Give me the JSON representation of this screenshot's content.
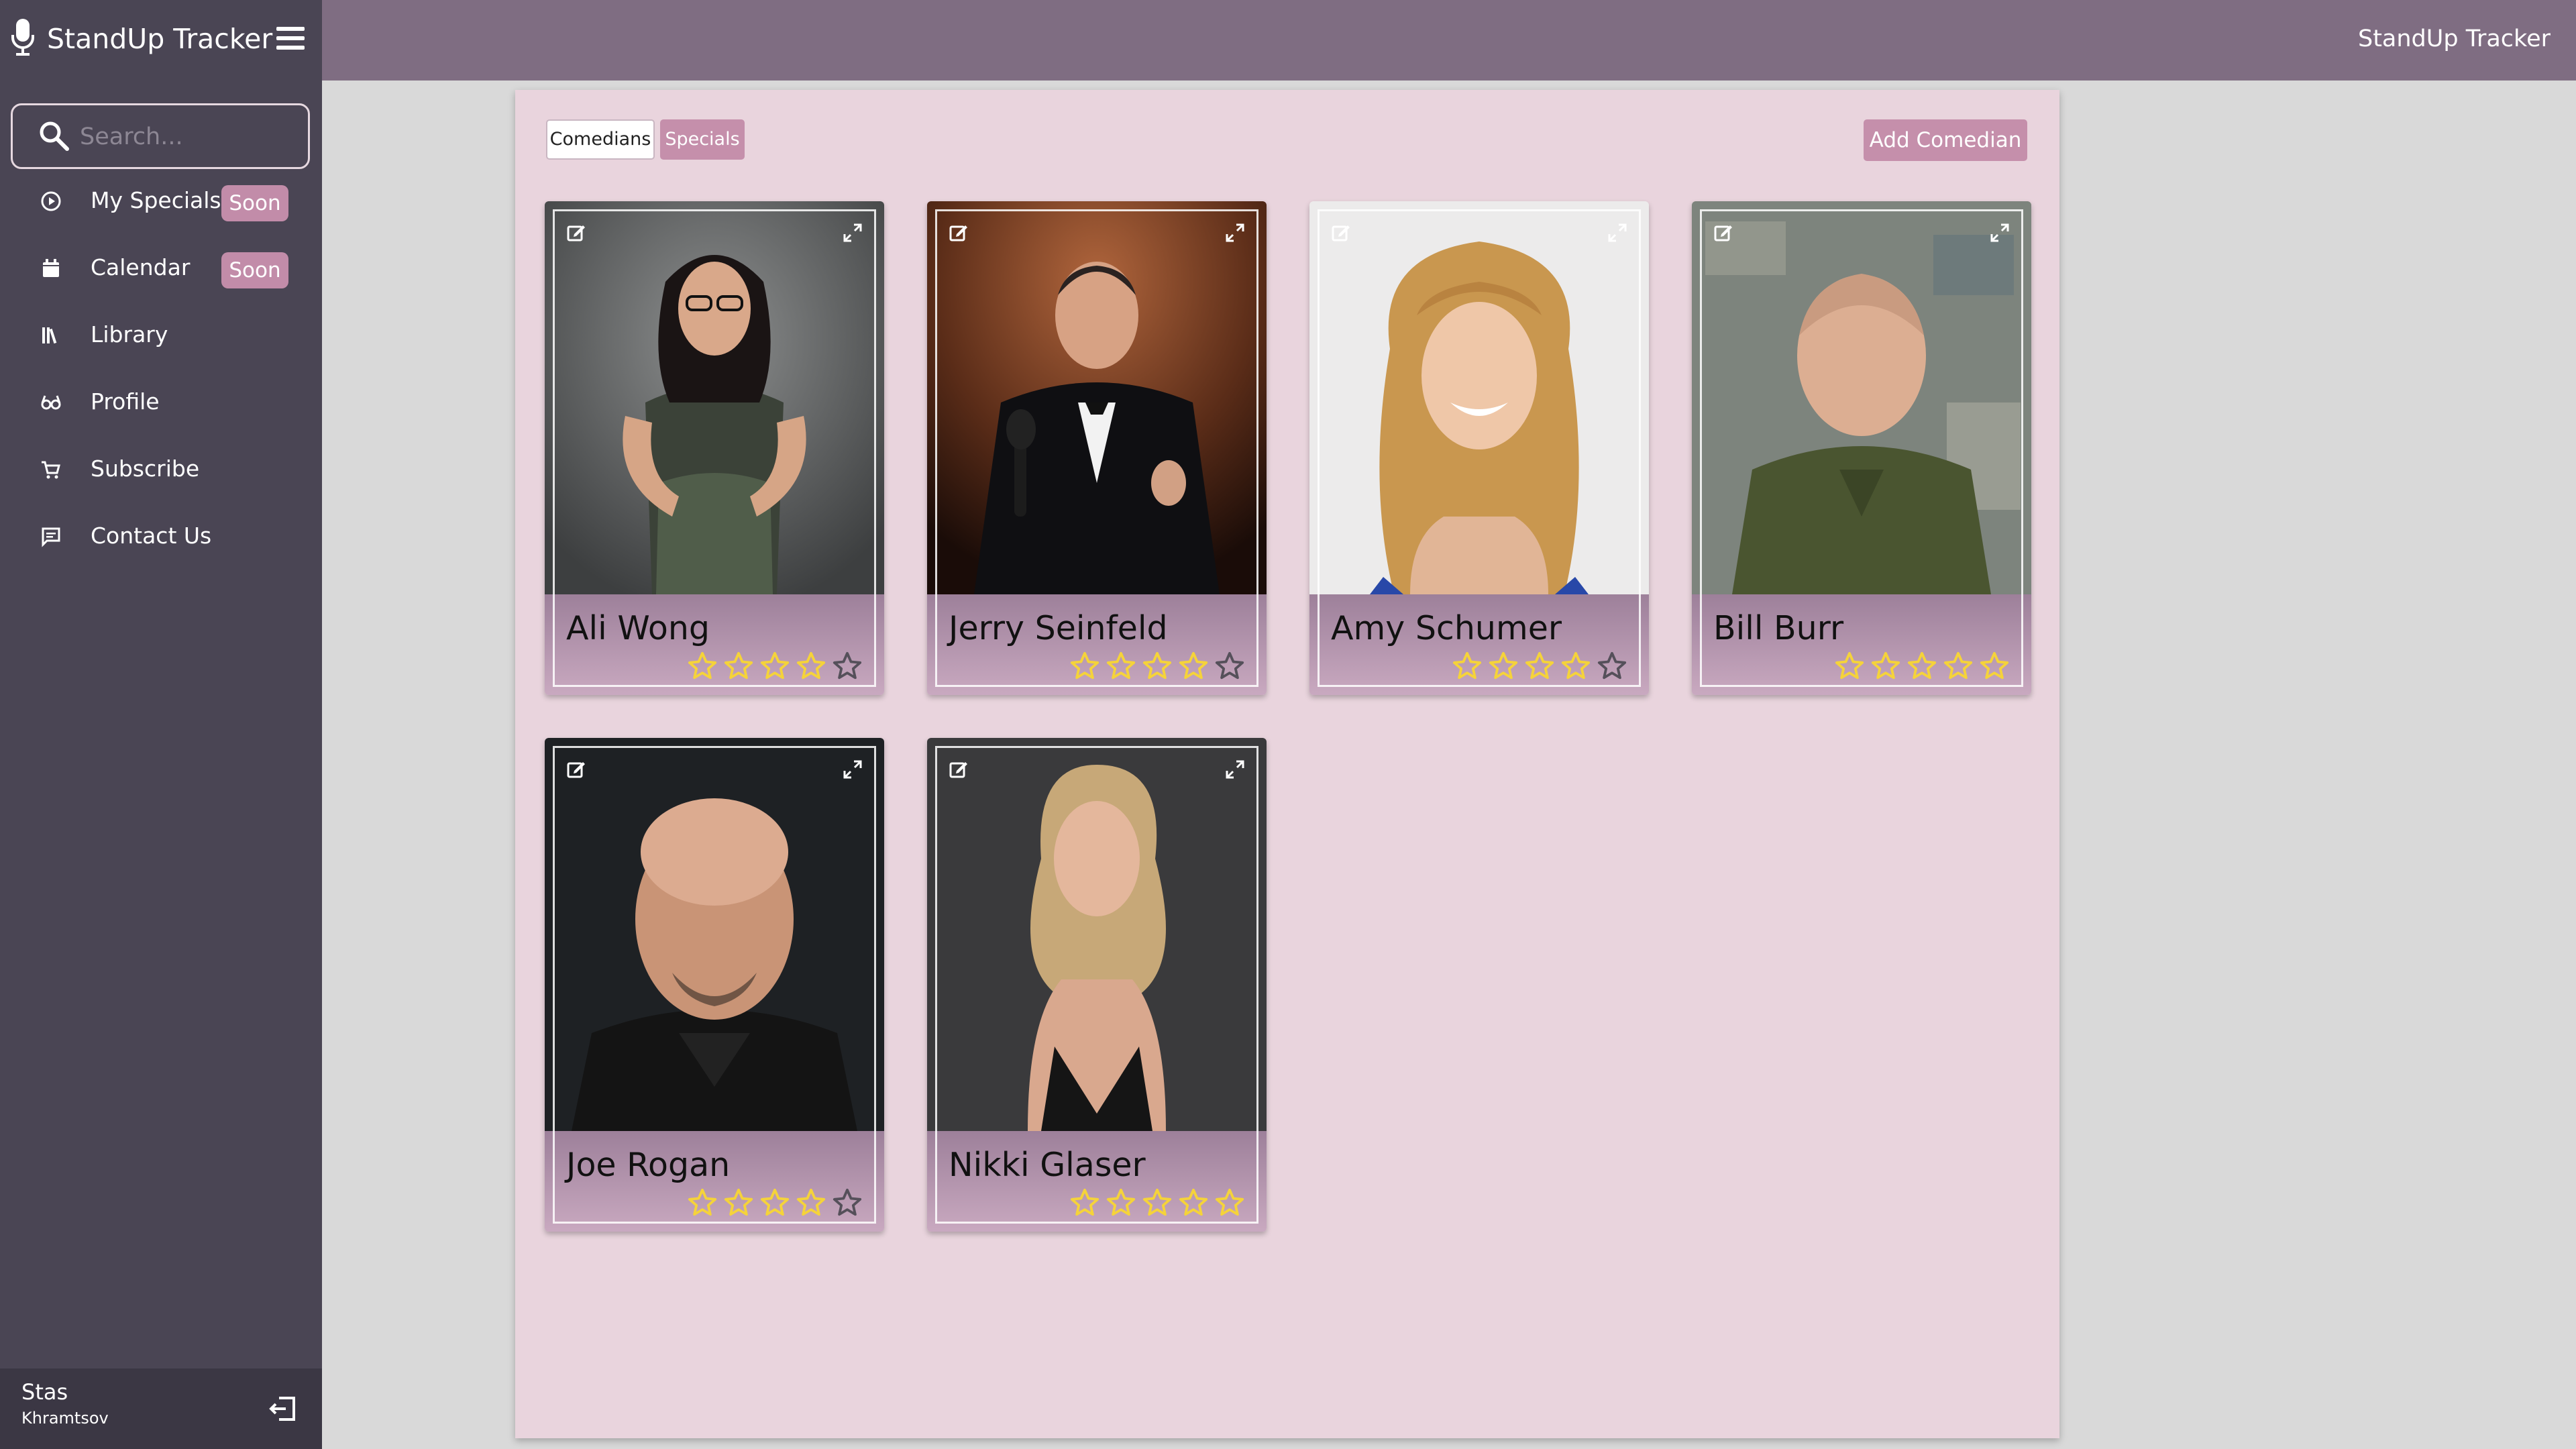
{
  "app": {
    "title": "StandUp Tracker",
    "header_title": "StandUp Tracker"
  },
  "search": {
    "placeholder": "Search..."
  },
  "nav": [
    {
      "label": "My Specials",
      "icon": "play-circle-icon",
      "badge": "Soon"
    },
    {
      "label": "Calendar",
      "icon": "calendar-icon",
      "badge": "Soon"
    },
    {
      "label": "Library",
      "icon": "library-icon",
      "badge": ""
    },
    {
      "label": "Profile",
      "icon": "glasses-icon",
      "badge": ""
    },
    {
      "label": "Subscribe",
      "icon": "cart-icon",
      "badge": ""
    },
    {
      "label": "Contact Us",
      "icon": "message-icon",
      "badge": ""
    }
  ],
  "user": {
    "first_name": "Stas",
    "last_name": "Khramtsov"
  },
  "tabs": {
    "comedians": "Comedians",
    "specials": "Specials"
  },
  "actions": {
    "add_comedian": "Add Comedian"
  },
  "comedians": [
    {
      "name": "Ali Wong",
      "rating": 4
    },
    {
      "name": "Jerry Seinfeld",
      "rating": 4
    },
    {
      "name": "Amy Schumer",
      "rating": 4
    },
    {
      "name": "Bill Burr",
      "rating": 5
    },
    {
      "name": "Joe Rogan",
      "rating": 4
    },
    {
      "name": "Nikki Glaser",
      "rating": 5
    }
  ],
  "colors": {
    "sidebar": "#4a4554",
    "topbar": "#7f6d82",
    "panel": "#e9d4dd",
    "accent": "#c58fab",
    "star_filled": "#f5d33a",
    "star_empty": "#55505a"
  }
}
